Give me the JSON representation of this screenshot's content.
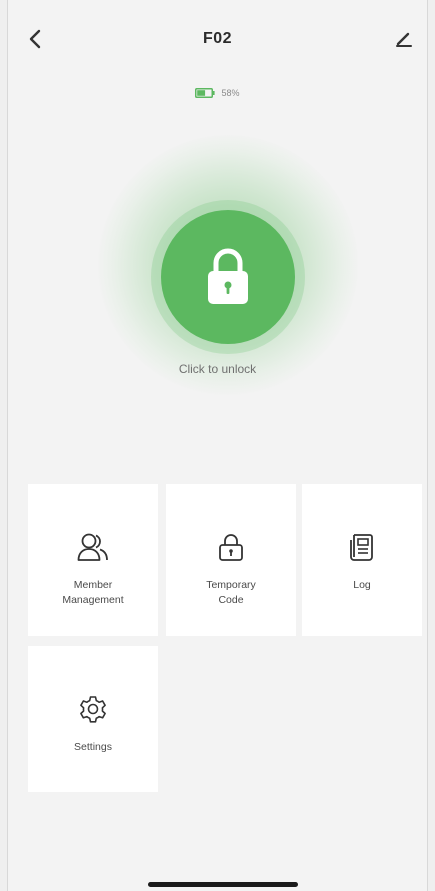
{
  "header": {
    "title": "F02"
  },
  "battery": {
    "level_text": "58%",
    "level_fraction": 0.58
  },
  "lock": {
    "label": "Click to unlock",
    "accent_color": "#5cb860"
  },
  "tiles": [
    {
      "label": "Member\nManagement",
      "icon": "members-icon"
    },
    {
      "label": "Temporary\nCode",
      "icon": "temporary-code-icon"
    },
    {
      "label": "Log",
      "icon": "log-icon"
    },
    {
      "label": "Settings",
      "icon": "gear-icon"
    }
  ]
}
